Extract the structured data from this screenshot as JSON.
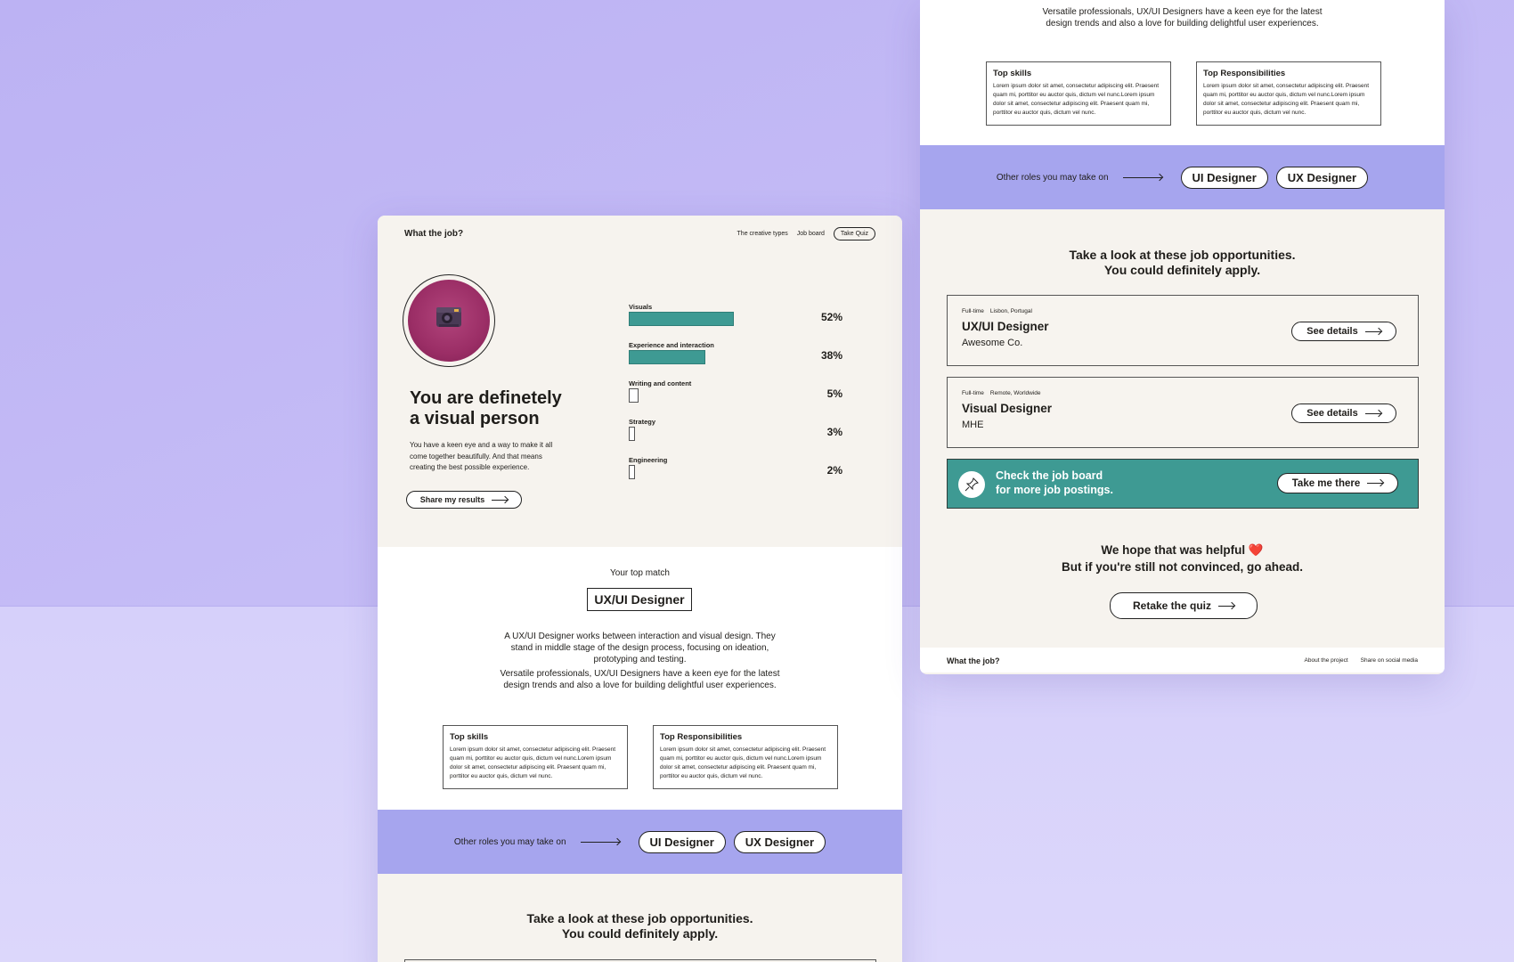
{
  "brand": "What the job?",
  "nav": {
    "links": [
      "The creative types",
      "Job board"
    ],
    "quiz_label": "Take Quiz"
  },
  "result": {
    "headline_line1": "You are definetely",
    "headline_line2": "a visual person",
    "lead": "You have a keen eye and a way to make it all come together beautifully. And that means creating the best possible experience.",
    "share_label": "Share my results"
  },
  "stats": [
    {
      "label": "Visuals",
      "percent_text": "52%",
      "percent": 52
    },
    {
      "label": "Experience and interaction",
      "percent_text": "38%",
      "percent": 38
    },
    {
      "label": "Writing and content",
      "percent_text": "5%",
      "percent": 5
    },
    {
      "label": "Strategy",
      "percent_text": "3%",
      "percent": 3
    },
    {
      "label": "Engineering",
      "percent_text": "2%",
      "percent": 2
    }
  ],
  "match": {
    "label": "Your top match",
    "role": "UX/UI Designer",
    "desc1": "A UX/UI Designer works between interaction and visual design. They stand in middle stage of the design process, focusing on ideation, prototyping and testing.",
    "desc2": "Versatile professionals, UX/UI Designers have a keen eye for the latest design trends and also a love for building delightful user experiences.",
    "skills_title": "Top skills",
    "skills_text": "Lorem ipsum dolor sit amet, consectetur adipiscing elit. Praesent quam mi, porttitor eu auctor quis, dictum vel nunc.Lorem ipsum dolor sit amet, consectetur adipiscing elit. Praesent quam mi, porttitor eu auctor quis, dictum vel nunc.",
    "resp_title": "Top Responsibilities",
    "resp_text": "Lorem ipsum dolor sit amet, consectetur adipiscing elit. Praesent quam mi, porttitor eu auctor quis, dictum vel nunc.Lorem ipsum dolor sit amet, consectetur adipiscing elit. Praesent quam mi, porttitor eu auctor quis, dictum vel nunc."
  },
  "roles": {
    "text": "Other roles you may take on",
    "items": [
      "UI Designer",
      "UX Designer"
    ]
  },
  "jobs": {
    "heading_line1": "Take a look at these job opportunities.",
    "heading_line2": "You could definitely apply.",
    "items": [
      {
        "type": "Full-time",
        "location": "Lisbon, Portugal",
        "title": "UX/UI Designer",
        "company": "Awesome Co.",
        "button": "See details"
      },
      {
        "type": "Full-time",
        "location": "Remote, Worldwide",
        "title": "Visual Designer",
        "company": "MHE",
        "button": "See details"
      }
    ]
  },
  "cta": {
    "line1": "Check the job board",
    "line2": "for more job postings.",
    "button": "Take me there"
  },
  "closing": {
    "line1": "We hope that was helpful ❤️",
    "line2": "But if you're still not convinced, go ahead.",
    "button": "Retake the quiz"
  },
  "footer": {
    "brand": "What the job?",
    "links": [
      "About the project",
      "Share on social media"
    ]
  },
  "colors": {
    "teal": "#3e9a93",
    "lavender": "#a6a5ee",
    "cream": "#f6f3ee",
    "background": "#c3b9f5"
  }
}
